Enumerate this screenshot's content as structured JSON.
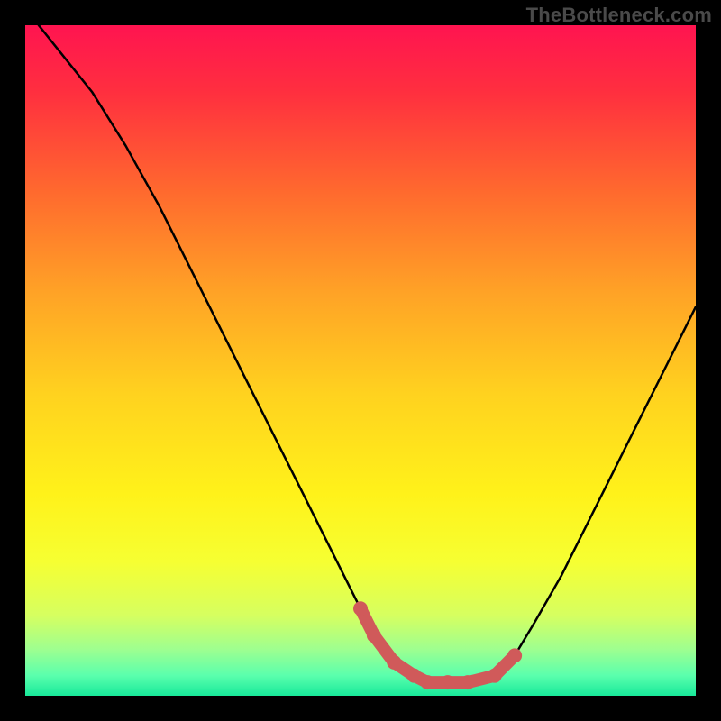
{
  "watermark": "TheBottleneck.com",
  "chart_data": {
    "type": "line",
    "title": "",
    "xlabel": "",
    "ylabel": "",
    "xlim": [
      0,
      100
    ],
    "ylim": [
      0,
      100
    ],
    "grid": false,
    "series": [
      {
        "name": "curve",
        "x": [
          2,
          6,
          10,
          15,
          20,
          25,
          30,
          35,
          40,
          45,
          50,
          52,
          55,
          58,
          60,
          63,
          66,
          70,
          73,
          76,
          80,
          84,
          88,
          92,
          96,
          100
        ],
        "y": [
          100,
          95,
          90,
          82,
          73,
          63,
          53,
          43,
          33,
          23,
          13,
          9,
          5,
          3,
          2,
          2,
          2,
          3,
          6,
          11,
          18,
          26,
          34,
          42,
          50,
          58
        ]
      }
    ],
    "highlight": {
      "name": "marker-band",
      "color": "#d05a5a",
      "x": [
        50,
        52,
        55,
        58,
        60,
        63,
        66,
        70,
        73
      ],
      "y": [
        13,
        9,
        5,
        3,
        2,
        2,
        2,
        3,
        6
      ]
    },
    "background_gradient": {
      "stops": [
        {
          "offset": 0.0,
          "color": "#ff1450"
        },
        {
          "offset": 0.1,
          "color": "#ff2f3f"
        },
        {
          "offset": 0.25,
          "color": "#ff6a2e"
        },
        {
          "offset": 0.4,
          "color": "#ffa326"
        },
        {
          "offset": 0.55,
          "color": "#ffd21f"
        },
        {
          "offset": 0.7,
          "color": "#fff21a"
        },
        {
          "offset": 0.8,
          "color": "#f6ff32"
        },
        {
          "offset": 0.88,
          "color": "#d6ff60"
        },
        {
          "offset": 0.93,
          "color": "#9fff8f"
        },
        {
          "offset": 0.97,
          "color": "#5affad"
        },
        {
          "offset": 1.0,
          "color": "#18e99a"
        }
      ]
    }
  }
}
